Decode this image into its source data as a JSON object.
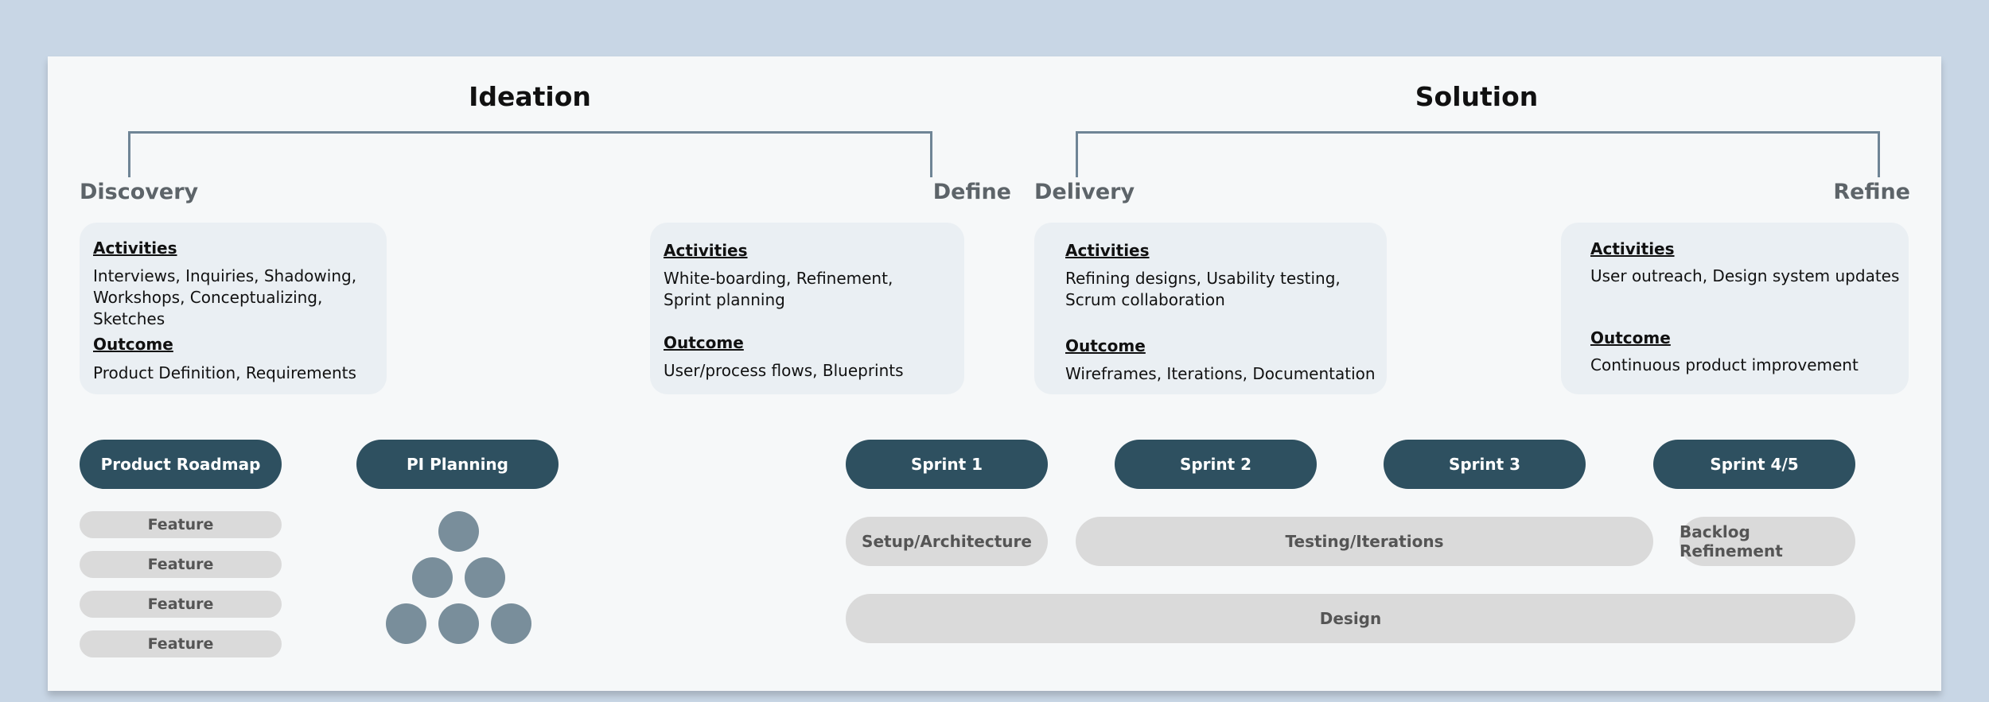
{
  "phases": {
    "ideation": {
      "title": "Ideation",
      "start": "Discovery",
      "end": "Define"
    },
    "solution": {
      "title": "Solution",
      "start": "Delivery",
      "end": "Refine"
    }
  },
  "cards": {
    "discovery": {
      "activities_label": "Activities",
      "activities": "Interviews, Inquiries, Shadowing,\nWorkshops, Conceptualizing, Sketches",
      "outcome_label": "Outcome",
      "outcome": "Product Definition, Requirements"
    },
    "define": {
      "activities_label": "Activities",
      "activities": "White-boarding, Refinement,\nSprint planning",
      "outcome_label": "Outcome",
      "outcome": "User/process flows, Blueprints"
    },
    "delivery": {
      "activities_label": "Activities",
      "activities": "Refining designs, Usability testing,\nScrum collaboration",
      "outcome_label": "Outcome",
      "outcome": "Wireframes, Iterations, Documentation"
    },
    "refine": {
      "activities_label": "Activities",
      "activities": "User outreach, Design system updates",
      "outcome_label": "Outcome",
      "outcome": "Continuous product improvement"
    }
  },
  "roadmap": {
    "label": "Product Roadmap",
    "features": [
      "Feature",
      "Feature",
      "Feature",
      "Feature"
    ]
  },
  "pi_planning": {
    "label": "PI Planning"
  },
  "sprints": [
    "Sprint 1",
    "Sprint 2",
    "Sprint 3",
    "Sprint 4/5"
  ],
  "workstreams": {
    "setup": "Setup/Architecture",
    "testing": "Testing/Iterations",
    "backlog": "Backlog Refinement",
    "design": "Design"
  },
  "colors": {
    "background": "#c8d6e5",
    "canvas": "#f6f8f9",
    "card": "#eaeff3",
    "pill_dark": "#2e5060",
    "pill_light": "#dadada",
    "bracket": "#6f8596",
    "team_dot": "#798e9b"
  }
}
